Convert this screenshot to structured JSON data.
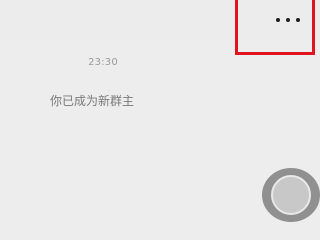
{
  "header": {
    "more_icon": "more-horizontal-icon"
  },
  "chat": {
    "timestamp": "23:30",
    "system_message": "你已成为新群主"
  },
  "overlay": {
    "highlight_color": "#e0141e",
    "assistive_icon": "assistive-touch-icon"
  }
}
